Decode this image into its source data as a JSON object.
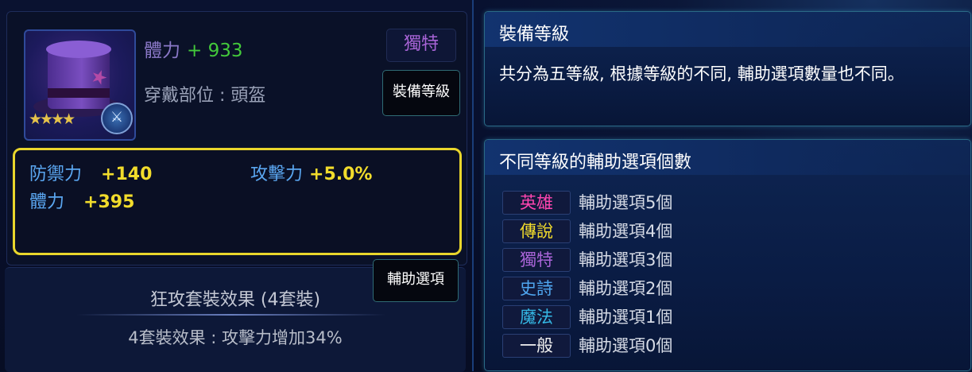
{
  "colors": {
    "hero": "#ff45b0",
    "legend": "#f2dc2c",
    "unique": "#a864d6",
    "epic": "#4fa6f0",
    "magic": "#35b9e6",
    "normal": "#f0f0f0",
    "stat_value": "#43c93b",
    "option_highlight": "#e9d62c"
  },
  "item": {
    "main_stat_label": "體力",
    "main_stat_value": "+ 933",
    "slot": "穿戴部位 : 頭盔",
    "rarity": "獨特",
    "star_icon": "star-icon",
    "grade_button": "裝備等級",
    "assist_button": "輔助選項",
    "options": [
      {
        "label": "防禦力",
        "value": "+140"
      },
      {
        "label": "攻擊力",
        "value": "+5.0%"
      },
      {
        "label": "體力",
        "value": "+395"
      }
    ],
    "set": {
      "title": "狂攻套裝效果 (4套裝)",
      "effect": "4套裝效果 : 攻擊力增加34%"
    }
  },
  "info": {
    "grade_panel": {
      "title": "裝備等級",
      "text": "共分為五等級, 根據等級的不同, 輔助選項數量也不同。"
    },
    "options_panel": {
      "title": "不同等級的輔助選項個數",
      "rows": [
        {
          "grade": "英雄",
          "desc": "輔助選項5個"
        },
        {
          "grade": "傳說",
          "desc": "輔助選項4個"
        },
        {
          "grade": "獨特",
          "desc": "輔助選項3個"
        },
        {
          "grade": "史詩",
          "desc": "輔助選項2個"
        },
        {
          "grade": "魔法",
          "desc": "輔助選項1個"
        },
        {
          "grade": "一般",
          "desc": "輔助選項0個"
        }
      ]
    }
  }
}
